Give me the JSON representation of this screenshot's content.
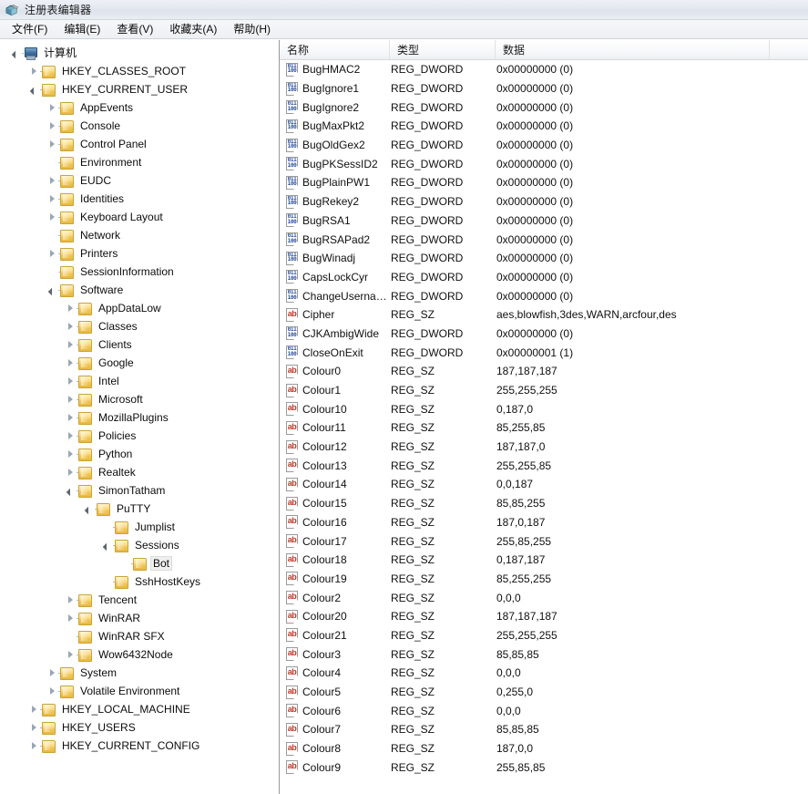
{
  "window": {
    "title": "注册表编辑器",
    "icon": "regedit-icon"
  },
  "menu": [
    {
      "label": "文件(F)",
      "name": "menu-file"
    },
    {
      "label": "编辑(E)",
      "name": "menu-edit"
    },
    {
      "label": "查看(V)",
      "name": "menu-view"
    },
    {
      "label": "收藏夹(A)",
      "name": "menu-favorites"
    },
    {
      "label": "帮助(H)",
      "name": "menu-help"
    }
  ],
  "tree": {
    "nodes": [
      {
        "label": "计算机",
        "depth": 0,
        "state": "expanded",
        "icon": "computer-icon",
        "selected": false
      },
      {
        "label": "HKEY_CLASSES_ROOT",
        "depth": 1,
        "state": "collapsed",
        "icon": "folder-icon",
        "selected": false
      },
      {
        "label": "HKEY_CURRENT_USER",
        "depth": 1,
        "state": "expanded",
        "icon": "folder-icon",
        "selected": false
      },
      {
        "label": "AppEvents",
        "depth": 2,
        "state": "collapsed",
        "icon": "folder-icon",
        "selected": false
      },
      {
        "label": "Console",
        "depth": 2,
        "state": "collapsed",
        "icon": "folder-icon",
        "selected": false
      },
      {
        "label": "Control Panel",
        "depth": 2,
        "state": "collapsed",
        "icon": "folder-icon",
        "selected": false
      },
      {
        "label": "Environment",
        "depth": 2,
        "state": "leaf",
        "icon": "folder-icon",
        "selected": false
      },
      {
        "label": "EUDC",
        "depth": 2,
        "state": "collapsed",
        "icon": "folder-icon",
        "selected": false
      },
      {
        "label": "Identities",
        "depth": 2,
        "state": "collapsed",
        "icon": "folder-icon",
        "selected": false
      },
      {
        "label": "Keyboard Layout",
        "depth": 2,
        "state": "collapsed",
        "icon": "folder-icon",
        "selected": false
      },
      {
        "label": "Network",
        "depth": 2,
        "state": "leaf",
        "icon": "folder-icon",
        "selected": false
      },
      {
        "label": "Printers",
        "depth": 2,
        "state": "collapsed",
        "icon": "folder-icon",
        "selected": false
      },
      {
        "label": "SessionInformation",
        "depth": 2,
        "state": "leaf",
        "icon": "folder-icon",
        "selected": false
      },
      {
        "label": "Software",
        "depth": 2,
        "state": "expanded",
        "icon": "folder-icon",
        "selected": false
      },
      {
        "label": "AppDataLow",
        "depth": 3,
        "state": "collapsed",
        "icon": "folder-icon",
        "selected": false
      },
      {
        "label": "Classes",
        "depth": 3,
        "state": "collapsed",
        "icon": "folder-icon",
        "selected": false
      },
      {
        "label": "Clients",
        "depth": 3,
        "state": "collapsed",
        "icon": "folder-icon",
        "selected": false
      },
      {
        "label": "Google",
        "depth": 3,
        "state": "collapsed",
        "icon": "folder-icon",
        "selected": false
      },
      {
        "label": "Intel",
        "depth": 3,
        "state": "collapsed",
        "icon": "folder-icon",
        "selected": false
      },
      {
        "label": "Microsoft",
        "depth": 3,
        "state": "collapsed",
        "icon": "folder-icon",
        "selected": false
      },
      {
        "label": "MozillaPlugins",
        "depth": 3,
        "state": "collapsed",
        "icon": "folder-icon",
        "selected": false
      },
      {
        "label": "Policies",
        "depth": 3,
        "state": "collapsed",
        "icon": "folder-icon",
        "selected": false
      },
      {
        "label": "Python",
        "depth": 3,
        "state": "collapsed",
        "icon": "folder-icon",
        "selected": false
      },
      {
        "label": "Realtek",
        "depth": 3,
        "state": "collapsed",
        "icon": "folder-icon",
        "selected": false
      },
      {
        "label": "SimonTatham",
        "depth": 3,
        "state": "expanded",
        "icon": "folder-icon",
        "selected": false
      },
      {
        "label": "PuTTY",
        "depth": 4,
        "state": "expanded",
        "icon": "folder-icon",
        "selected": false
      },
      {
        "label": "Jumplist",
        "depth": 5,
        "state": "leaf",
        "icon": "folder-icon",
        "selected": false
      },
      {
        "label": "Sessions",
        "depth": 5,
        "state": "expanded",
        "icon": "folder-icon",
        "selected": false
      },
      {
        "label": "Bot",
        "depth": 6,
        "state": "leaf",
        "icon": "folder-icon",
        "selected": true
      },
      {
        "label": "SshHostKeys",
        "depth": 5,
        "state": "leaf",
        "icon": "folder-icon",
        "selected": false
      },
      {
        "label": "Tencent",
        "depth": 3,
        "state": "collapsed",
        "icon": "folder-icon",
        "selected": false
      },
      {
        "label": "WinRAR",
        "depth": 3,
        "state": "collapsed",
        "icon": "folder-icon",
        "selected": false
      },
      {
        "label": "WinRAR SFX",
        "depth": 3,
        "state": "leaf",
        "icon": "folder-icon",
        "selected": false
      },
      {
        "label": "Wow6432Node",
        "depth": 3,
        "state": "collapsed",
        "icon": "folder-icon",
        "selected": false
      },
      {
        "label": "System",
        "depth": 2,
        "state": "collapsed",
        "icon": "folder-icon",
        "selected": false
      },
      {
        "label": "Volatile Environment",
        "depth": 2,
        "state": "collapsed",
        "icon": "folder-icon",
        "selected": false
      },
      {
        "label": "HKEY_LOCAL_MACHINE",
        "depth": 1,
        "state": "collapsed",
        "icon": "folder-icon",
        "selected": false
      },
      {
        "label": "HKEY_USERS",
        "depth": 1,
        "state": "collapsed",
        "icon": "folder-icon",
        "selected": false
      },
      {
        "label": "HKEY_CURRENT_CONFIG",
        "depth": 1,
        "state": "collapsed",
        "icon": "folder-icon",
        "selected": false
      }
    ]
  },
  "list": {
    "columns": [
      {
        "label": "名称",
        "name": "column-header-name"
      },
      {
        "label": "类型",
        "name": "column-header-type"
      },
      {
        "label": "数据",
        "name": "column-header-data"
      }
    ],
    "rows": [
      {
        "name": "BugHMAC2",
        "type": "REG_DWORD",
        "data": "0x00000000 (0)"
      },
      {
        "name": "BugIgnore1",
        "type": "REG_DWORD",
        "data": "0x00000000 (0)"
      },
      {
        "name": "BugIgnore2",
        "type": "REG_DWORD",
        "data": "0x00000000 (0)"
      },
      {
        "name": "BugMaxPkt2",
        "type": "REG_DWORD",
        "data": "0x00000000 (0)"
      },
      {
        "name": "BugOldGex2",
        "type": "REG_DWORD",
        "data": "0x00000000 (0)"
      },
      {
        "name": "BugPKSessID2",
        "type": "REG_DWORD",
        "data": "0x00000000 (0)"
      },
      {
        "name": "BugPlainPW1",
        "type": "REG_DWORD",
        "data": "0x00000000 (0)"
      },
      {
        "name": "BugRekey2",
        "type": "REG_DWORD",
        "data": "0x00000000 (0)"
      },
      {
        "name": "BugRSA1",
        "type": "REG_DWORD",
        "data": "0x00000000 (0)"
      },
      {
        "name": "BugRSAPad2",
        "type": "REG_DWORD",
        "data": "0x00000000 (0)"
      },
      {
        "name": "BugWinadj",
        "type": "REG_DWORD",
        "data": "0x00000000 (0)"
      },
      {
        "name": "CapsLockCyr",
        "type": "REG_DWORD",
        "data": "0x00000000 (0)"
      },
      {
        "name": "ChangeUserna…",
        "type": "REG_DWORD",
        "data": "0x00000000 (0)"
      },
      {
        "name": "Cipher",
        "type": "REG_SZ",
        "data": "aes,blowfish,3des,WARN,arcfour,des"
      },
      {
        "name": "CJKAmbigWide",
        "type": "REG_DWORD",
        "data": "0x00000000 (0)"
      },
      {
        "name": "CloseOnExit",
        "type": "REG_DWORD",
        "data": "0x00000001 (1)"
      },
      {
        "name": "Colour0",
        "type": "REG_SZ",
        "data": "187,187,187"
      },
      {
        "name": "Colour1",
        "type": "REG_SZ",
        "data": "255,255,255"
      },
      {
        "name": "Colour10",
        "type": "REG_SZ",
        "data": "0,187,0"
      },
      {
        "name": "Colour11",
        "type": "REG_SZ",
        "data": "85,255,85"
      },
      {
        "name": "Colour12",
        "type": "REG_SZ",
        "data": "187,187,0"
      },
      {
        "name": "Colour13",
        "type": "REG_SZ",
        "data": "255,255,85"
      },
      {
        "name": "Colour14",
        "type": "REG_SZ",
        "data": "0,0,187"
      },
      {
        "name": "Colour15",
        "type": "REG_SZ",
        "data": "85,85,255"
      },
      {
        "name": "Colour16",
        "type": "REG_SZ",
        "data": "187,0,187"
      },
      {
        "name": "Colour17",
        "type": "REG_SZ",
        "data": "255,85,255"
      },
      {
        "name": "Colour18",
        "type": "REG_SZ",
        "data": "0,187,187"
      },
      {
        "name": "Colour19",
        "type": "REG_SZ",
        "data": "85,255,255"
      },
      {
        "name": "Colour2",
        "type": "REG_SZ",
        "data": "0,0,0"
      },
      {
        "name": "Colour20",
        "type": "REG_SZ",
        "data": "187,187,187"
      },
      {
        "name": "Colour21",
        "type": "REG_SZ",
        "data": "255,255,255"
      },
      {
        "name": "Colour3",
        "type": "REG_SZ",
        "data": "85,85,85"
      },
      {
        "name": "Colour4",
        "type": "REG_SZ",
        "data": "0,0,0"
      },
      {
        "name": "Colour5",
        "type": "REG_SZ",
        "data": "0,255,0"
      },
      {
        "name": "Colour6",
        "type": "REG_SZ",
        "data": "0,0,0"
      },
      {
        "name": "Colour7",
        "type": "REG_SZ",
        "data": "85,85,85"
      },
      {
        "name": "Colour8",
        "type": "REG_SZ",
        "data": "187,0,0"
      },
      {
        "name": "Colour9",
        "type": "REG_SZ",
        "data": "255,85,85"
      },
      {
        "name": "",
        "type": "",
        "data": ""
      }
    ]
  },
  "icons": {
    "dword_glyph": "011\n100",
    "sz_glyph": "ab"
  },
  "colors": {
    "selection": "#efefef",
    "dword_icon": "#2b4f9e",
    "sz_icon": "#c0392b",
    "folder": "#f0c554"
  }
}
